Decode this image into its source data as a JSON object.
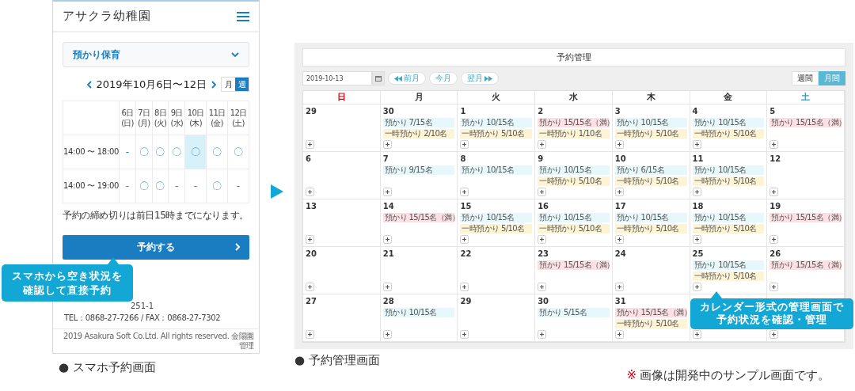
{
  "phone": {
    "title": "アサクラ幼稚園",
    "select": {
      "value": "預かり保育"
    },
    "range": "2019年10月6日〜12日",
    "views": [
      {
        "label": "月",
        "selected": false
      },
      {
        "label": "週",
        "selected": true
      }
    ],
    "columns": [
      {
        "date": "6日",
        "weekday": "(日)"
      },
      {
        "date": "7日",
        "weekday": "(月)"
      },
      {
        "date": "8日",
        "weekday": "(火)"
      },
      {
        "date": "9日",
        "weekday": "(水)"
      },
      {
        "date": "10日",
        "weekday": "(木)"
      },
      {
        "date": "11日",
        "weekday": "(金)"
      },
      {
        "date": "12日",
        "weekday": "(土)"
      }
    ],
    "rows": [
      {
        "time": "14:00 〜 18:00",
        "slots": [
          {
            "mark": "-",
            "highlighted": false
          },
          {
            "mark": "〇",
            "highlighted": false
          },
          {
            "mark": "〇",
            "highlighted": false
          },
          {
            "mark": "〇",
            "highlighted": false
          },
          {
            "mark": "〇",
            "highlighted": true
          },
          {
            "mark": "〇",
            "highlighted": false
          },
          {
            "mark": "〇",
            "highlighted": false
          }
        ]
      },
      {
        "time": "14:00 〜 19:00",
        "slots": [
          {
            "mark": "-",
            "highlighted": false
          },
          {
            "mark": "〇",
            "highlighted": false
          },
          {
            "mark": "〇",
            "highlighted": false
          },
          {
            "mark": "-",
            "highlighted": false
          },
          {
            "mark": "-",
            "highlighted": false
          },
          {
            "mark": "〇",
            "highlighted": false
          },
          {
            "mark": "-",
            "highlighted": false
          }
        ]
      }
    ],
    "notice": "予約の締め切りは前日15時までになります。",
    "reserve_button": "予約する",
    "address": "251-1",
    "contact": "TEL：0868-27-7266 / FAX：0868-27-7302",
    "copyright": "2019 Asakura Soft Co.Ltd. All rights reserved. 金陽園管理",
    "callout": [
      "スマホから空き状況を",
      "確認して直接予約"
    ],
    "caption": "● スマホ予約画面"
  },
  "admin": {
    "title": "予約管理",
    "date_field": {
      "value": "2019-10-13"
    },
    "nav_buttons": [
      {
        "label": "前月",
        "kind": "prev"
      },
      {
        "label": "今月",
        "kind": "current"
      },
      {
        "label": "翌月",
        "kind": "next"
      }
    ],
    "views": [
      {
        "label": "週間",
        "selected": false
      },
      {
        "label": "月間",
        "selected": true
      }
    ],
    "weekdays": [
      {
        "label": "日",
        "color": "#e60012"
      },
      {
        "label": "月",
        "color": "#333333"
      },
      {
        "label": "火",
        "color": "#333333"
      },
      {
        "label": "水",
        "color": "#333333"
      },
      {
        "label": "木",
        "color": "#333333"
      },
      {
        "label": "金",
        "color": "#333333"
      },
      {
        "label": "土",
        "color": "#2a9fd0"
      }
    ],
    "weeks": [
      [
        {
          "date": "29"
        },
        {
          "date": "30",
          "entries": [
            {
              "text": "預かり 7/15名",
              "kind": "regular"
            },
            {
              "text": "一時預かり 2/10名",
              "kind": "temporary"
            }
          ]
        },
        {
          "date": "1",
          "entries": [
            {
              "text": "預かり 10/15名",
              "kind": "regular"
            },
            {
              "text": "一時預かり 5/10名",
              "kind": "temporary"
            }
          ]
        },
        {
          "date": "2",
          "entries": [
            {
              "text": "預かり 15/15名（満）",
              "kind": "full"
            },
            {
              "text": "一時預かり 1/10名",
              "kind": "temporary"
            }
          ]
        },
        {
          "date": "3",
          "entries": [
            {
              "text": "預かり 10/15名",
              "kind": "regular"
            },
            {
              "text": "一時預かり 5/10名",
              "kind": "temporary"
            }
          ]
        },
        {
          "date": "4",
          "entries": [
            {
              "text": "預かり 10/15名",
              "kind": "regular"
            },
            {
              "text": "一時預かり 5/10名",
              "kind": "temporary"
            }
          ]
        },
        {
          "date": "5",
          "entries": [
            {
              "text": "預かり 15/15名（満）",
              "kind": "full"
            }
          ]
        }
      ],
      [
        {
          "date": "6"
        },
        {
          "date": "7",
          "entries": [
            {
              "text": "預かり 9/15名",
              "kind": "regular"
            }
          ]
        },
        {
          "date": "8",
          "entries": [
            {
              "text": "預かり 10/15名",
              "kind": "regular"
            }
          ]
        },
        {
          "date": "9",
          "entries": [
            {
              "text": "預かり 10/15名",
              "kind": "regular"
            },
            {
              "text": "一時預かり 5/10名",
              "kind": "temporary"
            }
          ]
        },
        {
          "date": "10",
          "entries": [
            {
              "text": "預かり 6/15名",
              "kind": "regular"
            },
            {
              "text": "一時預かり 5/10名",
              "kind": "temporary"
            }
          ]
        },
        {
          "date": "11",
          "entries": [
            {
              "text": "預かり 10/15名",
              "kind": "regular"
            },
            {
              "text": "一時預かり 5/10名",
              "kind": "temporary"
            }
          ]
        },
        {
          "date": "12"
        }
      ],
      [
        {
          "date": "13"
        },
        {
          "date": "14",
          "entries": [
            {
              "text": "預かり 15/15名（満）",
              "kind": "full"
            }
          ]
        },
        {
          "date": "15",
          "entries": [
            {
              "text": "預かり 10/15名",
              "kind": "regular"
            },
            {
              "text": "一時預かり 5/10名",
              "kind": "temporary"
            }
          ]
        },
        {
          "date": "16",
          "entries": [
            {
              "text": "預かり 10/15名",
              "kind": "regular"
            },
            {
              "text": "一時預かり 5/10名",
              "kind": "temporary"
            }
          ]
        },
        {
          "date": "17",
          "entries": [
            {
              "text": "預かり 10/15名",
              "kind": "regular"
            },
            {
              "text": "一時預かり 5/10名",
              "kind": "temporary"
            }
          ]
        },
        {
          "date": "18",
          "entries": [
            {
              "text": "預かり 10/15名",
              "kind": "regular"
            },
            {
              "text": "一時預かり 5/10名",
              "kind": "temporary"
            }
          ]
        },
        {
          "date": "19",
          "entries": [
            {
              "text": "預かり 15/15名（満）",
              "kind": "full"
            }
          ]
        }
      ],
      [
        {
          "date": "20"
        },
        {
          "date": "21"
        },
        {
          "date": "22"
        },
        {
          "date": "23",
          "entries": [
            {
              "text": "預かり 15/15名（満）",
              "kind": "full"
            }
          ]
        },
        {
          "date": "24"
        },
        {
          "date": "25",
          "entries": [
            {
              "text": "預かり 10/15名",
              "kind": "regular"
            },
            {
              "text": "一時預かり 5/10名",
              "kind": "temporary"
            }
          ]
        },
        {
          "date": "26",
          "entries": [
            {
              "text": "預かり 15/15名（満）",
              "kind": "full"
            }
          ]
        }
      ],
      [
        {
          "date": "27"
        },
        {
          "date": "28",
          "entries": [
            {
              "text": "預かり 10/15名",
              "kind": "regular"
            }
          ]
        },
        {
          "date": "29"
        },
        {
          "date": "30",
          "entries": [
            {
              "text": "預かり 5/15名",
              "kind": "regular"
            }
          ]
        },
        {
          "date": "31",
          "entries": [
            {
              "text": "預かり 15/15名（満）",
              "kind": "full"
            },
            {
              "text": "一時預かり 5/10名",
              "kind": "temporary"
            }
          ]
        }
      ]
    ],
    "callout": [
      "カレンダー形式の管理画面で",
      "予約状況を確認・管理"
    ],
    "caption": "● 予約管理画面",
    "note": {
      "mark": "※",
      "text": "画像は開発中のサンプル画面です。"
    }
  }
}
